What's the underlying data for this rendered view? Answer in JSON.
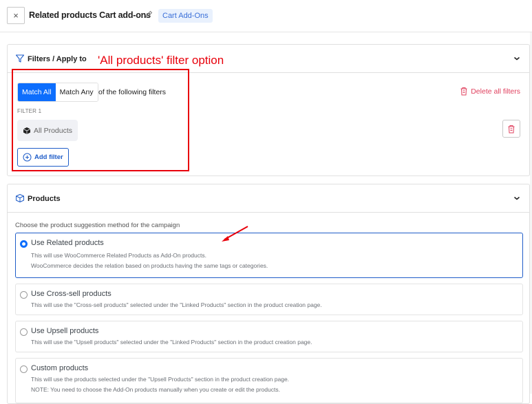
{
  "header": {
    "close_label": "×",
    "title": "Related products Cart add-ons",
    "badge": "Cart Add-Ons"
  },
  "filters": {
    "title": "Filters / Apply to",
    "match_all": "Match All",
    "match_any": "Match Any",
    "match_suffix": "of the following filters",
    "delete_all": "Delete all filters",
    "filter_label": "FILTER 1",
    "filter_value": "All Products",
    "add_filter": "Add filter"
  },
  "annotation": {
    "text": "'All products' filter option",
    "color": "#e8000b"
  },
  "products": {
    "title": "Products",
    "intro": "Choose the product suggestion method for the campaign",
    "options": [
      {
        "title": "Use Related products",
        "selected": true,
        "desc": [
          "This will use WooCommerce Related Products as Add-On products.",
          "WooCommerce decides the relation based on products having the same tags or categories."
        ]
      },
      {
        "title": "Use Cross-sell products",
        "selected": false,
        "desc": [
          "This will use the \"Cross-sell products\" selected under the \"Linked Products\" section in the product creation page."
        ]
      },
      {
        "title": "Use Upsell products",
        "selected": false,
        "desc": [
          "This will use the \"Upsell products\" selected under the \"Linked Products\" section in the product creation page."
        ]
      },
      {
        "title": "Custom products",
        "selected": false,
        "desc": [
          "This will use the products selected under the \"Upsell Products\" section in the product creation page.",
          "NOTE: You need to choose the Add-On products manually when you create or edit the products."
        ]
      }
    ]
  },
  "colors": {
    "primary": "#0d6efd",
    "danger": "#e0405e",
    "badge_bg": "#e9f1fd"
  }
}
